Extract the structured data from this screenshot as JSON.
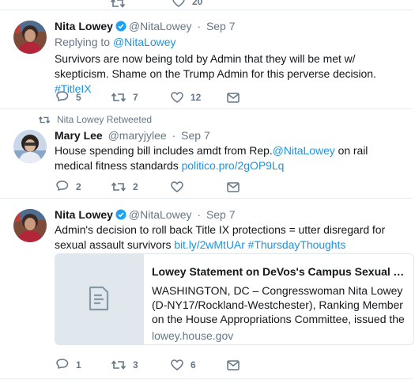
{
  "top_partial": {
    "retweets": "",
    "likes": "20"
  },
  "tweets": [
    {
      "name": "Nita Lowey",
      "handle": "@NitaLowey",
      "sep": "·",
      "date": "Sep 7",
      "replying_prefix": "Replying to",
      "replying_to": "@NitaLowey",
      "text": "Survivors are now being told by Admin that they will be met w/ skepticism. Shame on the Trump Admin for this perverse decision.",
      "hashtag": "#TitleIX",
      "replies": "5",
      "retweets": "7",
      "likes": "12"
    },
    {
      "retweet_label": "Nita Lowey Retweeted",
      "name": "Mary Lee",
      "handle": "@maryjylee",
      "sep": "·",
      "date": "Sep 7",
      "text_before": "House spending bill includes amdt from Rep.",
      "mention": "@NitaLowey",
      "text_after": " on rail medical fitness standards ",
      "link": "politico.pro/2gOP9Lq",
      "replies": "2",
      "retweets": "2",
      "likes": ""
    },
    {
      "name": "Nita Lowey",
      "handle": "@NitaLowey",
      "sep": "·",
      "date": "Sep 7",
      "text": "Admin's decision to roll back Title IX protections = utter disregard for sexual assault survivors ",
      "link": "bit.ly/2wMtUAr",
      "hashtag": "#ThursdayThoughts",
      "card": {
        "title": "Lowey Statement on DeVos's Campus Sexual Assault Policy",
        "description": "WASHINGTON, DC – Congresswoman Nita Lowey (D-NY17/Rockland-Westchester), Ranking Member on the House Appropriations Committee, issued the following statement",
        "domain": "lowey.house.gov"
      },
      "replies": "1",
      "retweets": "3",
      "likes": "6"
    }
  ],
  "colors": {
    "accent": "#1b95e0",
    "verified": "#1da1f2",
    "muted": "#657786",
    "divider": "#e6ecf0"
  },
  "icons": [
    "reply-icon",
    "retweet-icon",
    "like-icon",
    "dm-icon",
    "verified-icon",
    "document-icon"
  ]
}
